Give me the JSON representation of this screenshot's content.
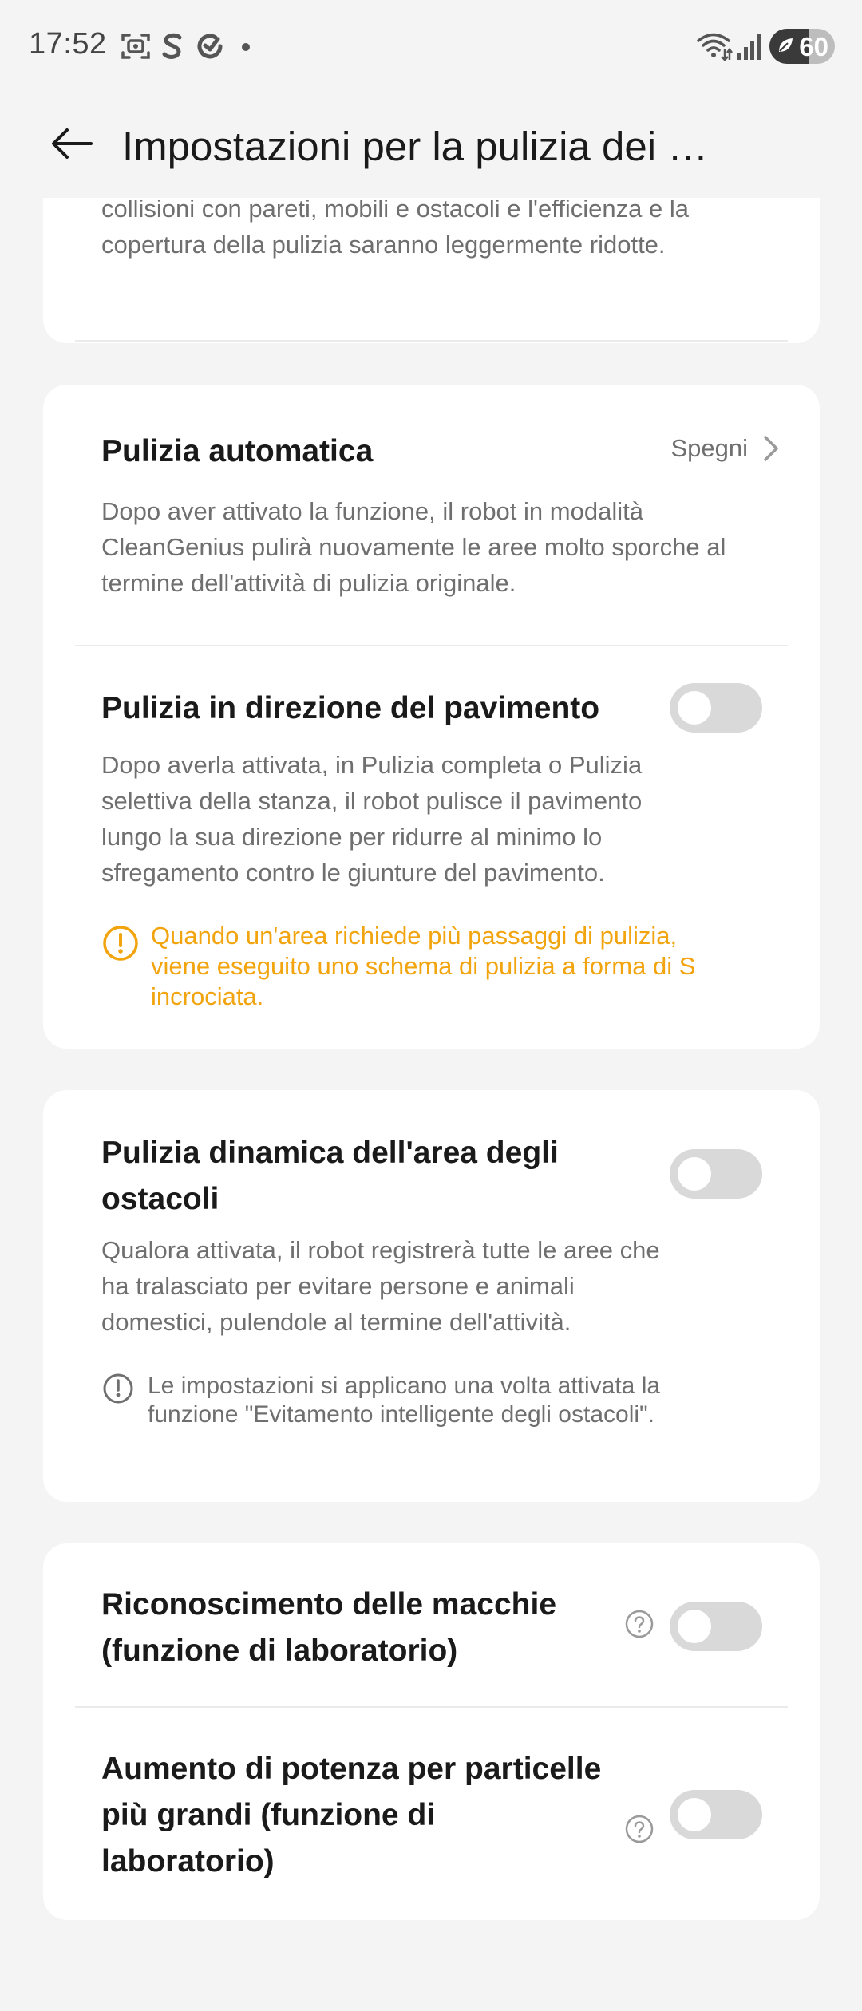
{
  "status_bar": {
    "time": "17:52",
    "battery_level": "60",
    "icons": [
      "screenshot-icon",
      "s-app-icon",
      "refresh-app-icon",
      "notification-dot",
      "wifi-icon",
      "signal-icon",
      "battery-icon"
    ]
  },
  "header": {
    "title": "Impostazioni per la pulizia dei …"
  },
  "card_top": {
    "desc": "collisioni con pareti, mobili e ostacoli e l'efficienza e la copertura della pulizia saranno leggermente ridotte."
  },
  "auto_clean": {
    "title": "Pulizia automatica",
    "value": "Spegni",
    "desc": "Dopo aver attivato la funzione, il robot in modalità CleanGenius pulirà nuovamente le aree molto sporche al termine dell'attività di pulizia originale."
  },
  "floor_direction": {
    "title": "Pulizia in direzione del pavimento",
    "enabled": false,
    "desc": "Dopo averla attivata, in Pulizia completa o Pulizia selettiva della stanza, il robot pulisce il pavimento lungo la sua direzione per ridurre al minimo lo sfregamento contro le giunture del pavimento.",
    "warning": "Quando un'area richiede più passaggi di pulizia, viene eseguito uno schema di pulizia a forma di S incrociata."
  },
  "dynamic_obstacle": {
    "title": "Pulizia dinamica dell'area degli ostacoli",
    "enabled": false,
    "desc": "Qualora attivata, il robot registrerà tutte le aree che ha tralasciato per evitare persone e animali domestici, pulendole al termine dell'attività.",
    "note": "Le impostazioni si applicano una volta attivata la funzione \"Evitamento intelligente degli ostacoli\"."
  },
  "stain_recognition": {
    "title": "Riconoscimento delle macchie (funzione di laboratorio)",
    "enabled": false
  },
  "power_boost": {
    "title": "Aumento di potenza per particelle più grandi (funzione di laboratorio)",
    "enabled": false
  },
  "colors": {
    "warning": "#f2a40e",
    "toggle_off": "#d9d9d9",
    "background": "#f4f4f4"
  }
}
